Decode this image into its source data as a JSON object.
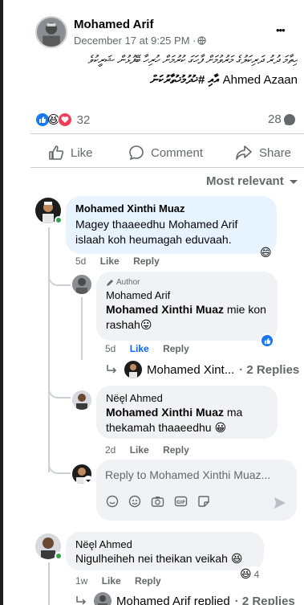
{
  "post": {
    "author": "Mohamed Arif",
    "timestamp": "December 17 at 9:25 PM · ",
    "text_dhivehi": "ހިތާމަ ދުރު ދަރިކަލުގެ މަރުވުމަށް ފާހަގަ ކުރުމަށް ހުރިހާ ބޭފުޅުން ޝަރީކުވެ",
    "text_line2_prefix": "Ahmed Azaan",
    "text_line2_dhivehi": "އާއި #ޚުދުމުޚުތާރުކަން",
    "reaction_count": "32",
    "comment_count": "28",
    "more_label": "•••"
  },
  "actions": {
    "like": "Like",
    "comment": "Comment",
    "share": "Share"
  },
  "sort": {
    "label": "Most relevant"
  },
  "comments": [
    {
      "name": "Mohamed Xinthi Muaz",
      "text": "Magey thaaeedhu Mohamed Arif islaah koh heumagah eduvaah.",
      "time": "5d",
      "like": "Like",
      "reply": "Reply",
      "reaction_emoji": "😄"
    }
  ],
  "reply1": {
    "author_badge": "Author",
    "name": "Mohamed Arif",
    "mention": "Mohamed Xinthi Muaz",
    "text": " mie kon rashah",
    "emoji": "😛",
    "time": "5d",
    "like": "Like",
    "reply": "Reply"
  },
  "subthread1": {
    "name": "Mohamed Xint...",
    "count": "· 2 Replies"
  },
  "reply2": {
    "name": "Nëęl Ahmed",
    "mention": "Mohamed Xinthi Muaz",
    "text_a": " ma",
    "text_b": "thekamah thaaeedhu",
    "emoji": "😀",
    "time": "2d",
    "like": "Like",
    "reply": "Reply"
  },
  "composer": {
    "placeholder": "Reply to Mohamed Xinthi Muaz..."
  },
  "comment2": {
    "name": "Nëęl Ahmed",
    "text": "Nigulheiheh nei theikan veikah",
    "emoji": "😆",
    "reaction_emoji": "😆",
    "reaction_count": "4",
    "time": "1w",
    "like": "Like",
    "reply": "Reply"
  },
  "subthread2": {
    "name": "Mohamed Arif replied",
    "count": "· 2 Replies"
  },
  "colors": {
    "accent": "#0866ff",
    "like_blue": "#1877f2",
    "love_red": "#f33e58",
    "online": "#31a24c"
  }
}
